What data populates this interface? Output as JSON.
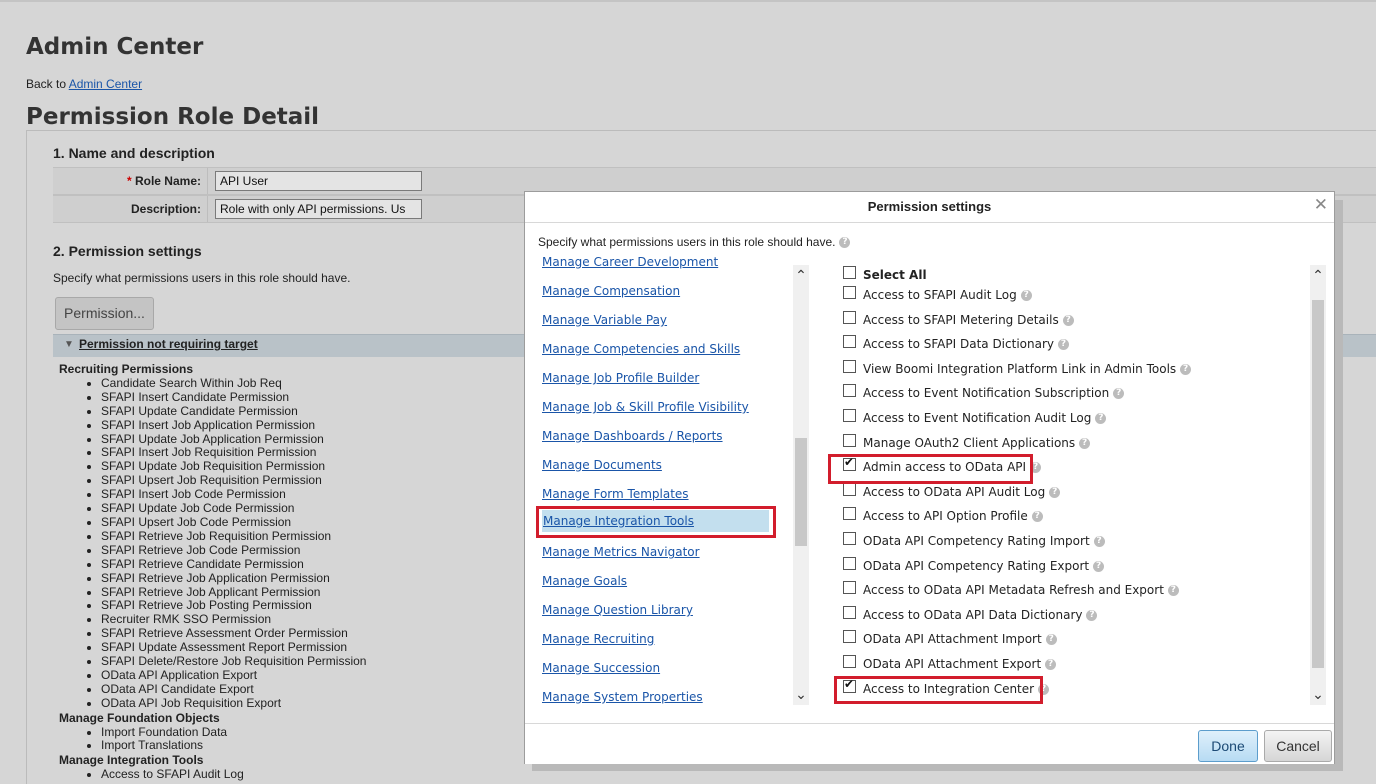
{
  "header": {
    "admin_title": "Admin Center",
    "back_prefix": "Back to",
    "back_link": "Admin Center",
    "page_title": "Permission Role Detail"
  },
  "section1": {
    "heading": "1. Name and description",
    "role_name_label": "Role Name:",
    "required_mark": "*",
    "role_name_value": "API User",
    "description_label": "Description:",
    "description_value": "Role with only API permissions. Us"
  },
  "section2": {
    "heading": "2. Permission settings",
    "description": "Specify what permissions users in this role should have.",
    "permission_button": "Permission...",
    "collapse_icon": "triangle-down-icon",
    "bar_label": "Permission not requiring target"
  },
  "permission_groups": [
    {
      "title": "Recruiting Permissions",
      "items": [
        "Candidate Search Within Job Req",
        "SFAPI Insert Candidate Permission",
        "SFAPI Update Candidate Permission",
        "SFAPI Insert Job Application Permission",
        "SFAPI Update Job Application Permission",
        "SFAPI Insert Job Requisition Permission",
        "SFAPI Update Job Requisition Permission",
        "SFAPI Upsert Job Requisition Permission",
        "SFAPI Insert Job Code Permission",
        "SFAPI Update Job Code Permission",
        "SFAPI Upsert Job Code Permission",
        "SFAPI Retrieve Job Requisition Permission",
        "SFAPI Retrieve Job Code Permission",
        "SFAPI Retrieve Candidate Permission",
        "SFAPI Retrieve Job Application Permission",
        "SFAPI Retrieve Job Applicant Permission",
        "SFAPI Retrieve Job Posting Permission",
        "Recruiter RMK SSO Permission",
        "SFAPI Retrieve Assessment Order Permission",
        "SFAPI Update Assessment Report Permission",
        "SFAPI Delete/Restore Job Requisition Permission",
        "OData API Application Export",
        "OData API Candidate Export",
        "OData API Job Requisition Export"
      ]
    },
    {
      "title": "Manage Foundation Objects",
      "items": [
        "Import Foundation Data",
        "Import Translations"
      ]
    },
    {
      "title": "Manage Integration Tools",
      "items": [
        "Access to SFAPI Audit Log"
      ]
    }
  ],
  "modal": {
    "title": "Permission settings",
    "close_icon": "close-icon",
    "description": "Specify what permissions users in this role should have.",
    "help_icon": "help-icon",
    "help_glyph": "?",
    "categories": [
      "Manage Career Development",
      "Manage Compensation",
      "Manage Variable Pay",
      "Manage Competencies and Skills",
      "Manage Job Profile Builder",
      "Manage Job & Skill Profile Visibility",
      "Manage Dashboards / Reports",
      "Manage Documents",
      "Manage Form Templates",
      "Manage Integration Tools",
      "Manage Metrics Navigator",
      "Manage Goals",
      "Manage Question Library",
      "Manage Recruiting",
      "Manage Succession",
      "Manage System Properties"
    ],
    "selected_category": "Manage Integration Tools",
    "select_all": "Select All",
    "permissions": [
      {
        "label": "Access to SFAPI Audit Log",
        "checked": false
      },
      {
        "label": "Access to SFAPI Metering Details",
        "checked": false
      },
      {
        "label": "Access to SFAPI Data Dictionary",
        "checked": false
      },
      {
        "label": "View Boomi Integration Platform Link in Admin Tools",
        "checked": false
      },
      {
        "label": "Access to Event Notification Subscription",
        "checked": false
      },
      {
        "label": "Access to Event Notification Audit Log",
        "checked": false
      },
      {
        "label": "Manage OAuth2 Client Applications",
        "checked": false
      },
      {
        "label": "Admin access to OData API",
        "checked": true
      },
      {
        "label": "Access to OData API Audit Log",
        "checked": false
      },
      {
        "label": "Access to API Option Profile",
        "checked": false
      },
      {
        "label": "OData API Competency Rating Import",
        "checked": false
      },
      {
        "label": "OData API Competency Rating Export",
        "checked": false
      },
      {
        "label": "Access to OData API Metadata Refresh and Export",
        "checked": false
      },
      {
        "label": "Access to OData API Data Dictionary",
        "checked": false
      },
      {
        "label": "OData API Attachment Import",
        "checked": false
      },
      {
        "label": "OData API Attachment Export",
        "checked": false
      },
      {
        "label": "Access to Integration Center",
        "checked": true
      }
    ],
    "done_button": "Done",
    "cancel_button": "Cancel",
    "scroll_up_icon": "chevron-up-icon",
    "scroll_down_icon": "chevron-down-icon",
    "highlight_color": "#d21d2c",
    "selected_bg": "#c3dfee"
  }
}
